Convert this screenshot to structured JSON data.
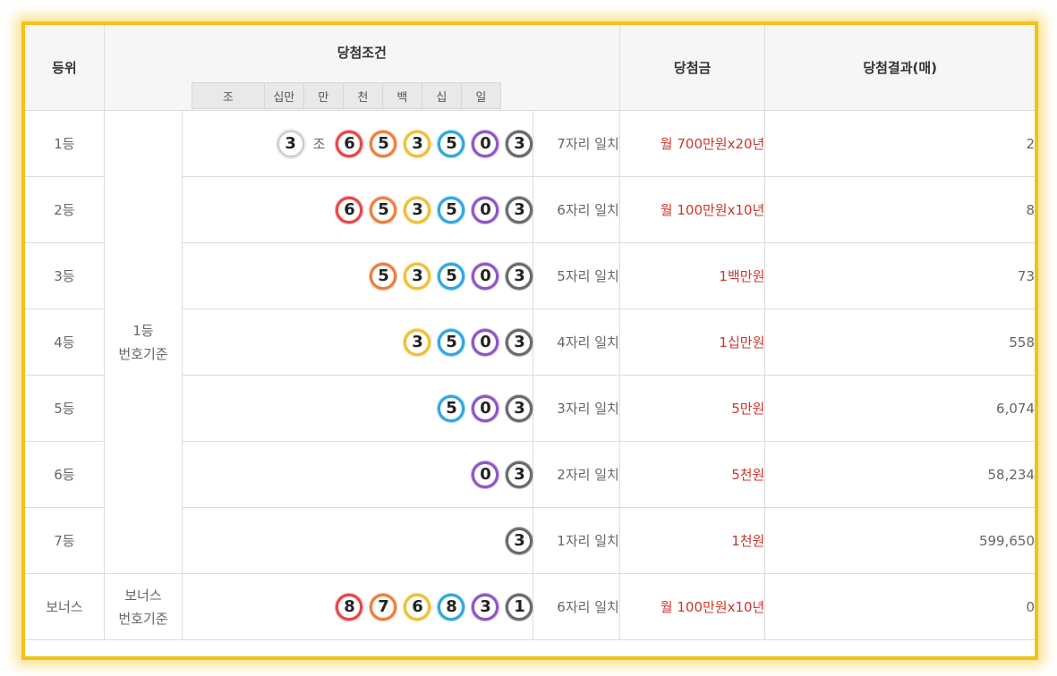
{
  "headers": {
    "rank": "등위",
    "condition": "당첨조건",
    "prize": "당첨금",
    "result": "당첨결과(매)"
  },
  "digit_headers": [
    "조",
    "십만",
    "만",
    "천",
    "백",
    "십",
    "일"
  ],
  "jo_label": "조",
  "basis": {
    "first_line1": "1등",
    "first_line2": "번호기준",
    "bonus_line1": "보너스",
    "bonus_line2": "번호기준"
  },
  "ball_colors": {
    "jo": "#c8c8c8",
    "6": "#e84646",
    "5": "#ef7d3b",
    "4": "#f1bf35",
    "3": "#2da8e2",
    "2": "#8e56c4",
    "1": "#6a6a6a"
  },
  "rows": [
    {
      "rank": "1등",
      "jo": "3",
      "digits": [
        "6",
        "5",
        "3",
        "5",
        "0",
        "3"
      ],
      "match": "7자리 일치",
      "prize": "월 700만원x20년",
      "count": "2"
    },
    {
      "rank": "2등",
      "digits": [
        "6",
        "5",
        "3",
        "5",
        "0",
        "3"
      ],
      "match": "6자리 일치",
      "prize": "월 100만원x10년",
      "count": "8"
    },
    {
      "rank": "3등",
      "digits": [
        "5",
        "3",
        "5",
        "0",
        "3"
      ],
      "match": "5자리 일치",
      "prize": "1백만원",
      "count": "73"
    },
    {
      "rank": "4등",
      "digits": [
        "3",
        "5",
        "0",
        "3"
      ],
      "match": "4자리 일치",
      "prize": "1십만원",
      "count": "558"
    },
    {
      "rank": "5등",
      "digits": [
        "5",
        "0",
        "3"
      ],
      "match": "3자리 일치",
      "prize": "5만원",
      "count": "6,074"
    },
    {
      "rank": "6등",
      "digits": [
        "0",
        "3"
      ],
      "match": "2자리 일치",
      "prize": "5천원",
      "count": "58,234"
    },
    {
      "rank": "7등",
      "digits": [
        "3"
      ],
      "match": "1자리 일치",
      "prize": "1천원",
      "count": "599,650"
    },
    {
      "rank": "보너스",
      "digits": [
        "8",
        "7",
        "6",
        "8",
        "3",
        "1"
      ],
      "match": "6자리 일치",
      "prize": "월 100만원x10년",
      "count": "0"
    }
  ]
}
